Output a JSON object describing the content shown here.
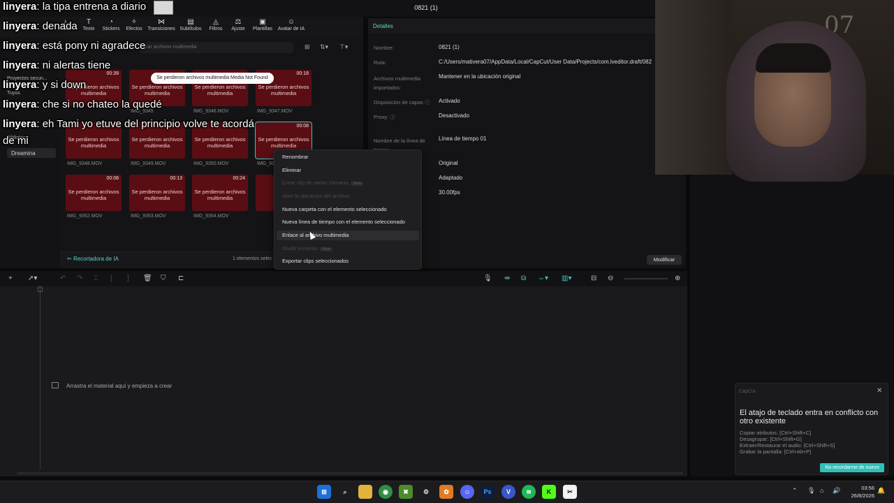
{
  "window": {
    "project_title": "0821 (1)"
  },
  "toolbar": {
    "items": [
      {
        "label": "Audio",
        "icon": "music-note-icon"
      },
      {
        "label": "Texto",
        "icon": "text-icon"
      },
      {
        "label": "Stickers",
        "icon": "sticker-icon"
      },
      {
        "label": "Efectos",
        "icon": "sparkle-icon"
      },
      {
        "label": "Transiciones",
        "icon": "transition-icon"
      },
      {
        "label": "Subtítulos",
        "icon": "subtitles-icon"
      },
      {
        "label": "Filtros",
        "icon": "filter-icon"
      },
      {
        "label": "Ajuste",
        "icon": "adjust-icon"
      },
      {
        "label": "Plantillas",
        "icon": "template-icon"
      },
      {
        "label": "Avatar de IA",
        "icon": "avatar-icon"
      }
    ]
  },
  "leftnav": {
    "items": [
      "Proyectos secun...",
      "Tuyos",
      "Biblioteca"
    ],
    "dreamina": "Dreamina"
  },
  "media": {
    "search_placeholder": "car archivos multimedia",
    "toast": "Se perdieron archivos multimedia Media Not Found",
    "error_text": "Se perdieron archivos multimedia",
    "rows": [
      [
        {
          "dur": "00:39",
          "name": ""
        },
        {
          "dur": "",
          "name": "IMG_9345"
        },
        {
          "dur": "",
          "name": "IMG_9346.MOV"
        },
        {
          "dur": "00:18",
          "name": "IMG_9347.MOV"
        }
      ],
      [
        {
          "dur": "",
          "name": "IMG_9348.MOV"
        },
        {
          "dur": "",
          "name": "IMG_9349.MOV"
        },
        {
          "dur": "",
          "name": "IMG_9350.MOV"
        },
        {
          "dur": "00:08",
          "name": "IMG_93"
        }
      ],
      [
        {
          "dur": "00:08",
          "name": "IMG_9352.MOV"
        },
        {
          "dur": "00:13",
          "name": "IMG_9353.MOV"
        },
        {
          "dur": "00:24",
          "name": "IMG_9354.MOV"
        },
        {
          "dur": "",
          "name": ""
        }
      ]
    ],
    "recortadora": "Recortadora de IA",
    "selected_count": "1 elementos selec"
  },
  "details": {
    "title": "Detalles",
    "fields": [
      {
        "key": "Nombre:",
        "value": "0821 (1)"
      },
      {
        "key": "Ruta:",
        "value": "C:/Users/mativera07/AppData/Local/CapCut/User Data/Projects/com.lveditor.draft/082"
      },
      {
        "key": "Archivos multimedia importados:",
        "value": "Mantener en la ubicación original"
      },
      {
        "key": "Disposición de capas",
        "value": "Activado"
      },
      {
        "key": "Proxy:",
        "value": "Desactivado"
      },
      {
        "key": "Nombre de la línea de tiempo",
        "value": "Línea de tiempo 01"
      }
    ],
    "extra_values": [
      "Original",
      "Adaptado",
      "30.00fps"
    ],
    "modify_label": "Modificar"
  },
  "context_menu": {
    "items": [
      {
        "label": "Renombrar",
        "disabled": false
      },
      {
        "label": "Eliminar",
        "disabled": false
      },
      {
        "label": "Crear clip de varias cámaras",
        "disabled": true,
        "badge": "New"
      },
      {
        "label": "Abrir la ubicación del archivo",
        "disabled": true
      },
      {
        "label": "Nueva carpeta con el elemento seleccionado",
        "disabled": false
      },
      {
        "label": "Nueva línea de tiempo con el elemento seleccionado",
        "disabled": false
      },
      {
        "label": "Enlace al archivo multimedia",
        "disabled": false
      },
      {
        "label": "Dividir escenas",
        "disabled": true,
        "badge": "New"
      },
      {
        "label": "Exportar clips seleccionados",
        "disabled": false
      }
    ]
  },
  "timeline": {
    "drop_hint": "Arrastra el material aquí y empieza a crear"
  },
  "notification": {
    "app": "CapCut",
    "title": "El atajo de teclado entra en conflicto con otro existente",
    "lines": [
      "Copiar atributos: [Ctrl+Shift+C]",
      "Desagrupar: [Ctrl+Shift+G]",
      "Extraer/Restaurar el audio: [Ctrl+Shift+S]",
      "Grabar la pantalla: [Ctrl+Alt+P]"
    ],
    "button": "No recordarme de nuevo"
  },
  "taskbar": {
    "apps": [
      "windows-start",
      "search",
      "file-explorer",
      "chrome",
      "minecraft",
      "app",
      "fl-studio",
      "discord",
      "photoshop",
      "vpn",
      "spotify",
      "kick",
      "capcut"
    ],
    "time": "03:56",
    "date": "26/8/2026"
  },
  "chat": [
    {
      "user": "linyera",
      "text": "la tipa entrena a diario"
    },
    {
      "user": "linyera",
      "text": "denada"
    },
    {
      "user": "linyera",
      "text": "está pony ni agradece"
    },
    {
      "user": "linyera",
      "text": "ni alertas tiene"
    },
    {
      "user": "linyera",
      "text": "y si down"
    },
    {
      "user": "linyera",
      "text": "che si no chateo la quedé"
    },
    {
      "user": "linyera",
      "text": "eh Tami yo etuve del principio volve te acordá"
    },
    {
      "user": "",
      "text": "de mi"
    }
  ],
  "webcam": {
    "wall_text": "07"
  }
}
